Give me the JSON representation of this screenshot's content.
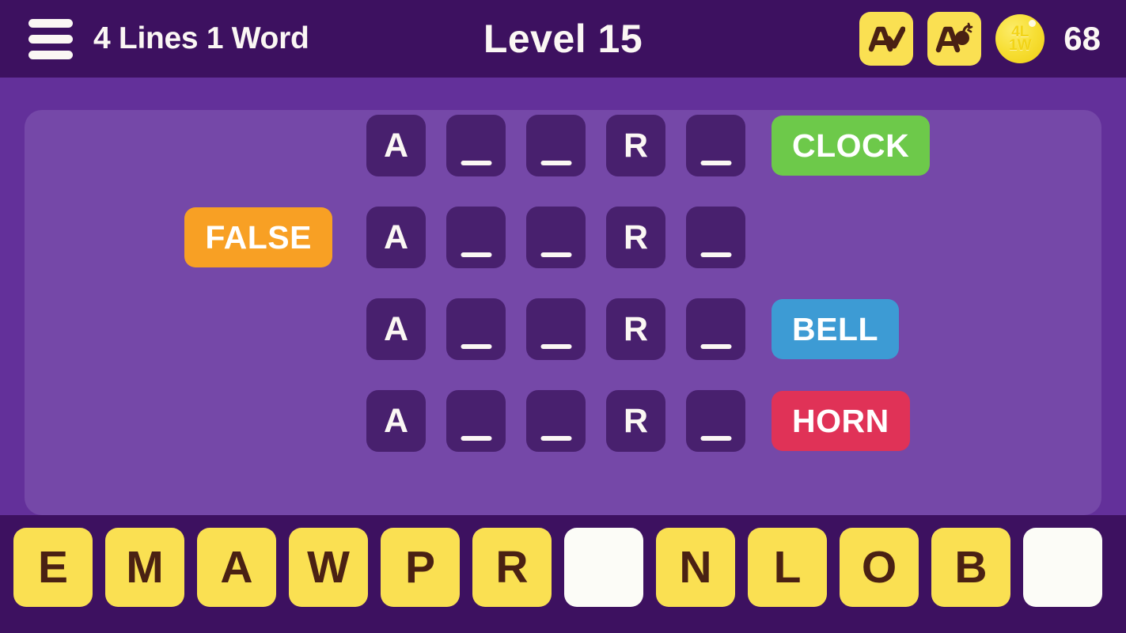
{
  "header": {
    "menu_icon": "hamburger-menu-icon",
    "app_title": "4 Lines 1 Word",
    "level_title": "Level 15",
    "powerups": [
      {
        "id": "reveal-letter",
        "icon": "a-checkmark-icon",
        "letter": "A"
      },
      {
        "id": "remove-letter",
        "icon": "a-bomb-icon",
        "letter": "A"
      }
    ],
    "coin": {
      "icon": "coin-icon",
      "line1": "4L",
      "line2": "1W",
      "count": "68"
    }
  },
  "board": {
    "rows": [
      {
        "tiles": [
          {
            "letter": "A",
            "filled": true
          },
          {
            "letter": "",
            "filled": false
          },
          {
            "letter": "",
            "filled": false
          },
          {
            "letter": "R",
            "filled": true
          },
          {
            "letter": "",
            "filled": false
          }
        ],
        "clue": {
          "label": "CLOCK",
          "color": "#6DC94A",
          "side": "right"
        }
      },
      {
        "tiles": [
          {
            "letter": "A",
            "filled": true
          },
          {
            "letter": "",
            "filled": false
          },
          {
            "letter": "",
            "filled": false
          },
          {
            "letter": "R",
            "filled": true
          },
          {
            "letter": "",
            "filled": false
          }
        ],
        "clue": {
          "label": "FALSE",
          "color": "#F8A024",
          "side": "left"
        }
      },
      {
        "tiles": [
          {
            "letter": "A",
            "filled": true
          },
          {
            "letter": "",
            "filled": false
          },
          {
            "letter": "",
            "filled": false
          },
          {
            "letter": "R",
            "filled": true
          },
          {
            "letter": "",
            "filled": false
          }
        ],
        "clue": {
          "label": "BELL",
          "color": "#3D9BD4",
          "side": "right"
        }
      },
      {
        "tiles": [
          {
            "letter": "A",
            "filled": true
          },
          {
            "letter": "",
            "filled": false
          },
          {
            "letter": "",
            "filled": false
          },
          {
            "letter": "R",
            "filled": true
          },
          {
            "letter": "",
            "filled": false
          }
        ],
        "clue": {
          "label": "HORN",
          "color": "#E03257",
          "side": "right"
        }
      }
    ]
  },
  "keyboard": {
    "keys": [
      {
        "letter": "E",
        "used": false
      },
      {
        "letter": "M",
        "used": false
      },
      {
        "letter": "A",
        "used": false
      },
      {
        "letter": "W",
        "used": false
      },
      {
        "letter": "P",
        "used": false
      },
      {
        "letter": "R",
        "used": false
      },
      {
        "letter": "",
        "used": true
      },
      {
        "letter": "N",
        "used": false
      },
      {
        "letter": "L",
        "used": false
      },
      {
        "letter": "O",
        "used": false
      },
      {
        "letter": "B",
        "used": false
      },
      {
        "letter": "",
        "used": true
      }
    ]
  },
  "colors": {
    "header_bg": "#3D1160",
    "body_bg": "#63309A",
    "panel_bg": "#7548A8",
    "tile_bg": "#48206E",
    "key_bg": "#FAE052",
    "key_text": "#4A2113",
    "text_light": "#FBF7F4"
  }
}
